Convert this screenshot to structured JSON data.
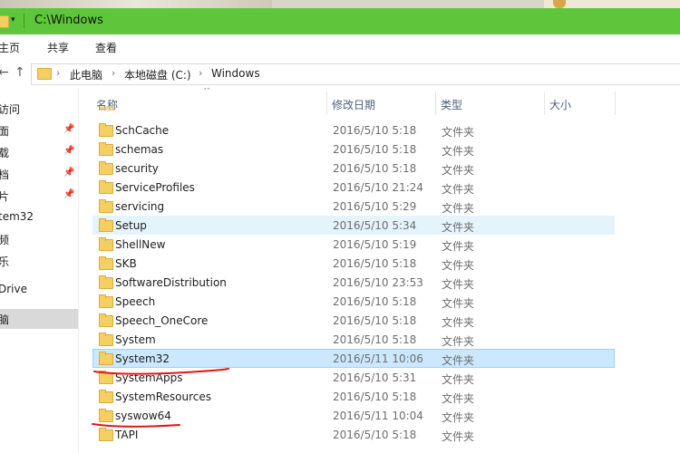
{
  "window": {
    "title": "C:\\Windows"
  },
  "ribbon": {
    "tabs": [
      "主页",
      "共享",
      "查看"
    ]
  },
  "address": {
    "crumbs": [
      "此电脑",
      "本地磁盘 (C:)",
      "Windows"
    ]
  },
  "nav": {
    "items": [
      {
        "label": "访问",
        "pinned": false,
        "selected": false
      },
      {
        "label": "面",
        "pinned": true,
        "selected": false
      },
      {
        "label": "载",
        "pinned": true,
        "selected": false
      },
      {
        "label": "档",
        "pinned": true,
        "selected": false
      },
      {
        "label": "片",
        "pinned": true,
        "selected": false
      },
      {
        "label": "tem32",
        "pinned": false,
        "selected": false
      },
      {
        "label": "频",
        "pinned": false,
        "selected": false
      },
      {
        "label": "乐",
        "pinned": false,
        "selected": false
      },
      {
        "label": "Drive",
        "pinned": false,
        "selected": false
      },
      {
        "label": "脑",
        "pinned": false,
        "selected": true
      }
    ]
  },
  "filelist": {
    "headers": {
      "name": "名称",
      "date": "修改日期",
      "type": "类型",
      "size": "大小"
    },
    "rows": [
      {
        "name": "SchCache",
        "date": "2016/5/10 5:18",
        "type": "文件夹",
        "state": "normal"
      },
      {
        "name": "schemas",
        "date": "2016/5/10 5:18",
        "type": "文件夹",
        "state": "normal"
      },
      {
        "name": "security",
        "date": "2016/5/10 5:18",
        "type": "文件夹",
        "state": "normal"
      },
      {
        "name": "ServiceProfiles",
        "date": "2016/5/10 21:24",
        "type": "文件夹",
        "state": "normal"
      },
      {
        "name": "servicing",
        "date": "2016/5/10 5:29",
        "type": "文件夹",
        "state": "normal"
      },
      {
        "name": "Setup",
        "date": "2016/5/10 5:34",
        "type": "文件夹",
        "state": "hover"
      },
      {
        "name": "ShellNew",
        "date": "2016/5/10 5:19",
        "type": "文件夹",
        "state": "normal"
      },
      {
        "name": "SKB",
        "date": "2016/5/10 5:18",
        "type": "文件夹",
        "state": "normal"
      },
      {
        "name": "SoftwareDistribution",
        "date": "2016/5/10 23:53",
        "type": "文件夹",
        "state": "normal"
      },
      {
        "name": "Speech",
        "date": "2016/5/10 5:18",
        "type": "文件夹",
        "state": "normal"
      },
      {
        "name": "Speech_OneCore",
        "date": "2016/5/10 5:18",
        "type": "文件夹",
        "state": "normal"
      },
      {
        "name": "System",
        "date": "2016/5/10 5:18",
        "type": "文件夹",
        "state": "normal"
      },
      {
        "name": "System32",
        "date": "2016/5/11 10:06",
        "type": "文件夹",
        "state": "selected"
      },
      {
        "name": "SystemApps",
        "date": "2016/5/10 5:31",
        "type": "文件夹",
        "state": "normal"
      },
      {
        "name": "SystemResources",
        "date": "2016/5/10 5:18",
        "type": "文件夹",
        "state": "normal"
      },
      {
        "name": "syswow64",
        "date": "2016/5/11 10:04",
        "type": "文件夹",
        "state": "normal"
      },
      {
        "name": "TAPI",
        "date": "2016/5/10 5:18",
        "type": "文件夹",
        "state": "normal"
      }
    ]
  },
  "colors": {
    "titlebar": "#5ec63a",
    "selection": "#cce8ff",
    "hover": "#e5f3fb",
    "annotation": "#e01818"
  }
}
